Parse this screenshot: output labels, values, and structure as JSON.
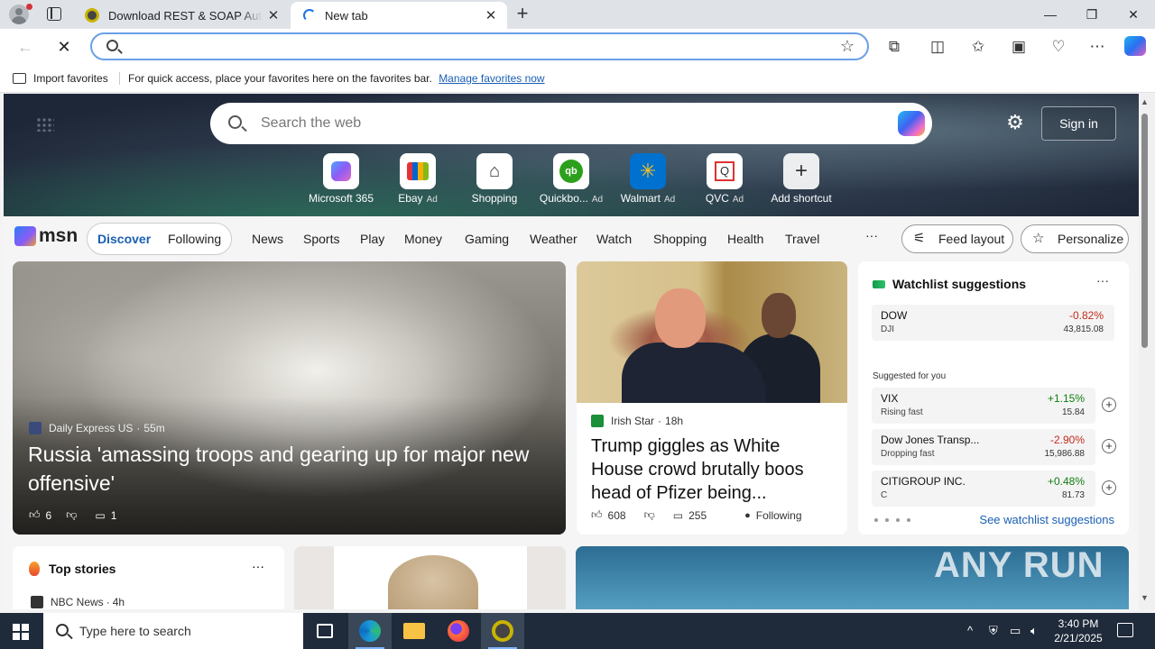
{
  "browser": {
    "tabs": [
      {
        "title": "Download REST & SOAP Automa",
        "active": false
      },
      {
        "title": "New tab",
        "active": true
      }
    ],
    "address_value": "",
    "favorites_bar": {
      "import_label": "Import favorites",
      "hint": "For quick access, place your favorites here on the favorites bar.",
      "link": "Manage favorites now"
    }
  },
  "newtab": {
    "search_placeholder": "Search the web",
    "sign_in": "Sign in",
    "shortcuts": [
      {
        "label": "Microsoft 365",
        "ad": ""
      },
      {
        "label": "Ebay",
        "ad": "Ad"
      },
      {
        "label": "Shopping",
        "ad": ""
      },
      {
        "label": "Quickbo...",
        "ad": "Ad"
      },
      {
        "label": "Walmart",
        "ad": "Ad"
      },
      {
        "label": "QVC",
        "ad": "Ad"
      },
      {
        "label": "Add shortcut",
        "ad": ""
      }
    ]
  },
  "msn": {
    "logo": "msn",
    "discover": "Discover",
    "following": "Following",
    "nav": [
      "News",
      "Sports",
      "Play",
      "Money",
      "Gaming",
      "Weather",
      "Watch",
      "Shopping",
      "Health",
      "Travel"
    ],
    "more": "···",
    "feed_layout": "Feed layout",
    "personalize": "Personalize"
  },
  "cards": {
    "main": {
      "source": "Daily Express US",
      "time": "55m",
      "headline": "Russia 'amassing troops and gearing up for major new offensive'",
      "likes": "6",
      "comments": "1"
    },
    "second": {
      "source": "Irish Star",
      "time": "18h",
      "headline": "Trump giggles as White House crowd brutally boos head of Pfizer being...",
      "likes": "608",
      "comments": "255",
      "following": "Following"
    },
    "watchlist": {
      "title": "Watchlist suggestions",
      "dow": {
        "name": "DOW",
        "sub": "DJI",
        "change": "-0.82%",
        "value": "43,815.08"
      },
      "suggested_label": "Suggested for you",
      "items": [
        {
          "name": "VIX",
          "sub": "Rising fast",
          "change": "+1.15%",
          "value": "15.84"
        },
        {
          "name": "Dow Jones Transp...",
          "sub": "Dropping fast",
          "change": "-2.90%",
          "value": "15,986.88"
        },
        {
          "name": "CITIGROUP INC.",
          "sub": "C",
          "change": "+0.48%",
          "value": "81.73"
        }
      ],
      "see_more": "See watchlist suggestions"
    },
    "top_stories": {
      "title": "Top stories",
      "first_source": "NBC News",
      "first_time": "4h"
    }
  },
  "taskbar": {
    "search_placeholder": "Type here to search",
    "time": "3:40 PM",
    "date": "2/21/2025"
  },
  "watermark": "ANY RUN"
}
